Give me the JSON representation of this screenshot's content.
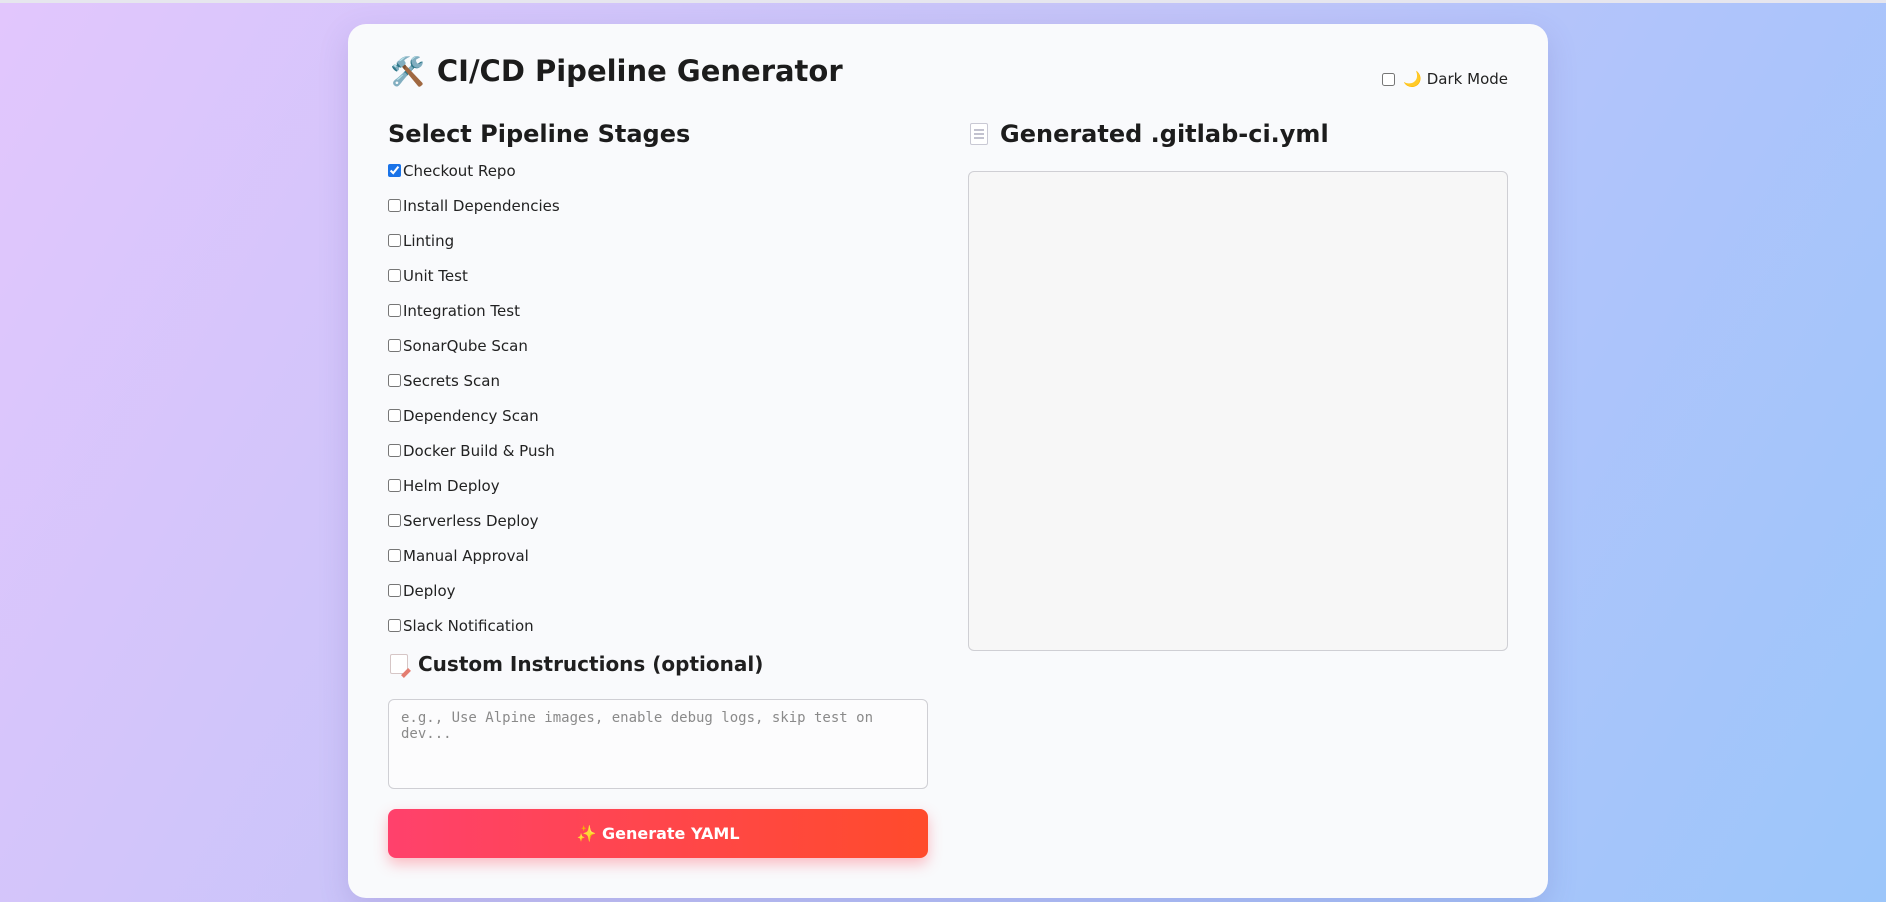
{
  "header": {
    "icon": "hammer-and-wrench-icon",
    "title": "CI/CD Pipeline Generator",
    "dark_mode": {
      "label": "🌙 Dark Mode",
      "checked": false
    }
  },
  "stages_section": {
    "title": "Select Pipeline Stages",
    "items": [
      {
        "label": "Checkout Repo",
        "checked": true
      },
      {
        "label": "Install Dependencies",
        "checked": false
      },
      {
        "label": "Linting",
        "checked": false
      },
      {
        "label": "Unit Test",
        "checked": false
      },
      {
        "label": "Integration Test",
        "checked": false
      },
      {
        "label": "SonarQube Scan",
        "checked": false
      },
      {
        "label": "Secrets Scan",
        "checked": false
      },
      {
        "label": "Dependency Scan",
        "checked": false
      },
      {
        "label": "Docker Build & Push",
        "checked": false
      },
      {
        "label": "Helm Deploy",
        "checked": false
      },
      {
        "label": "Serverless Deploy",
        "checked": false
      },
      {
        "label": "Manual Approval",
        "checked": false
      },
      {
        "label": "Deploy",
        "checked": false
      },
      {
        "label": "Slack Notification",
        "checked": false
      }
    ]
  },
  "custom": {
    "icon": "memo-icon",
    "title": "Custom Instructions (optional)",
    "placeholder": "e.g., Use Alpine images, enable debug logs, skip test on dev...",
    "value": ""
  },
  "generate_button": {
    "label": "✨ Generate YAML"
  },
  "output": {
    "icon": "document-icon",
    "title": "Generated .gitlab-ci.yml",
    "value": ""
  },
  "colors": {
    "button_gradient_start": "#ff416c",
    "button_gradient_end": "#ff4b2b",
    "checkbox_accent": "#1a73e8"
  }
}
